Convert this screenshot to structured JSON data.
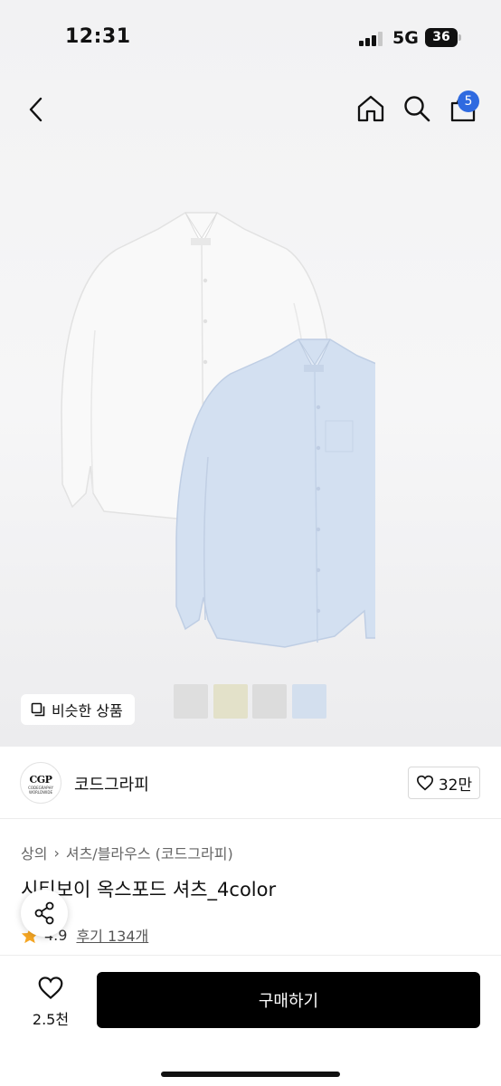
{
  "status_bar": {
    "time": "12:31",
    "network": "5G",
    "battery": "36"
  },
  "header": {
    "cart_count": "5"
  },
  "gallery": {
    "similar_label": "비슷한 상품",
    "swatches": [
      "#dedede",
      "#e3e1c9",
      "#dcdcdc",
      "#d3dfee"
    ]
  },
  "brand": {
    "logo_text": "CGP",
    "logo_subtext": "CODEGRAPHY WORLDWIDE",
    "name": "코드그라피",
    "likes": "32만"
  },
  "breadcrumb": {
    "level1": "상의",
    "level2": "셔츠/블라우스 (코드그라피)"
  },
  "product": {
    "title": "시티보이 옥스포드 셔츠_4color",
    "rating": "4.9",
    "reviews": "후기 134개"
  },
  "bottom_bar": {
    "wishlist_count": "2.5천",
    "buy_label": "구매하기"
  },
  "colors": {
    "accent_badge": "#2f6ae0",
    "rating_star": "#f5a623",
    "buy_button": "#000000"
  }
}
